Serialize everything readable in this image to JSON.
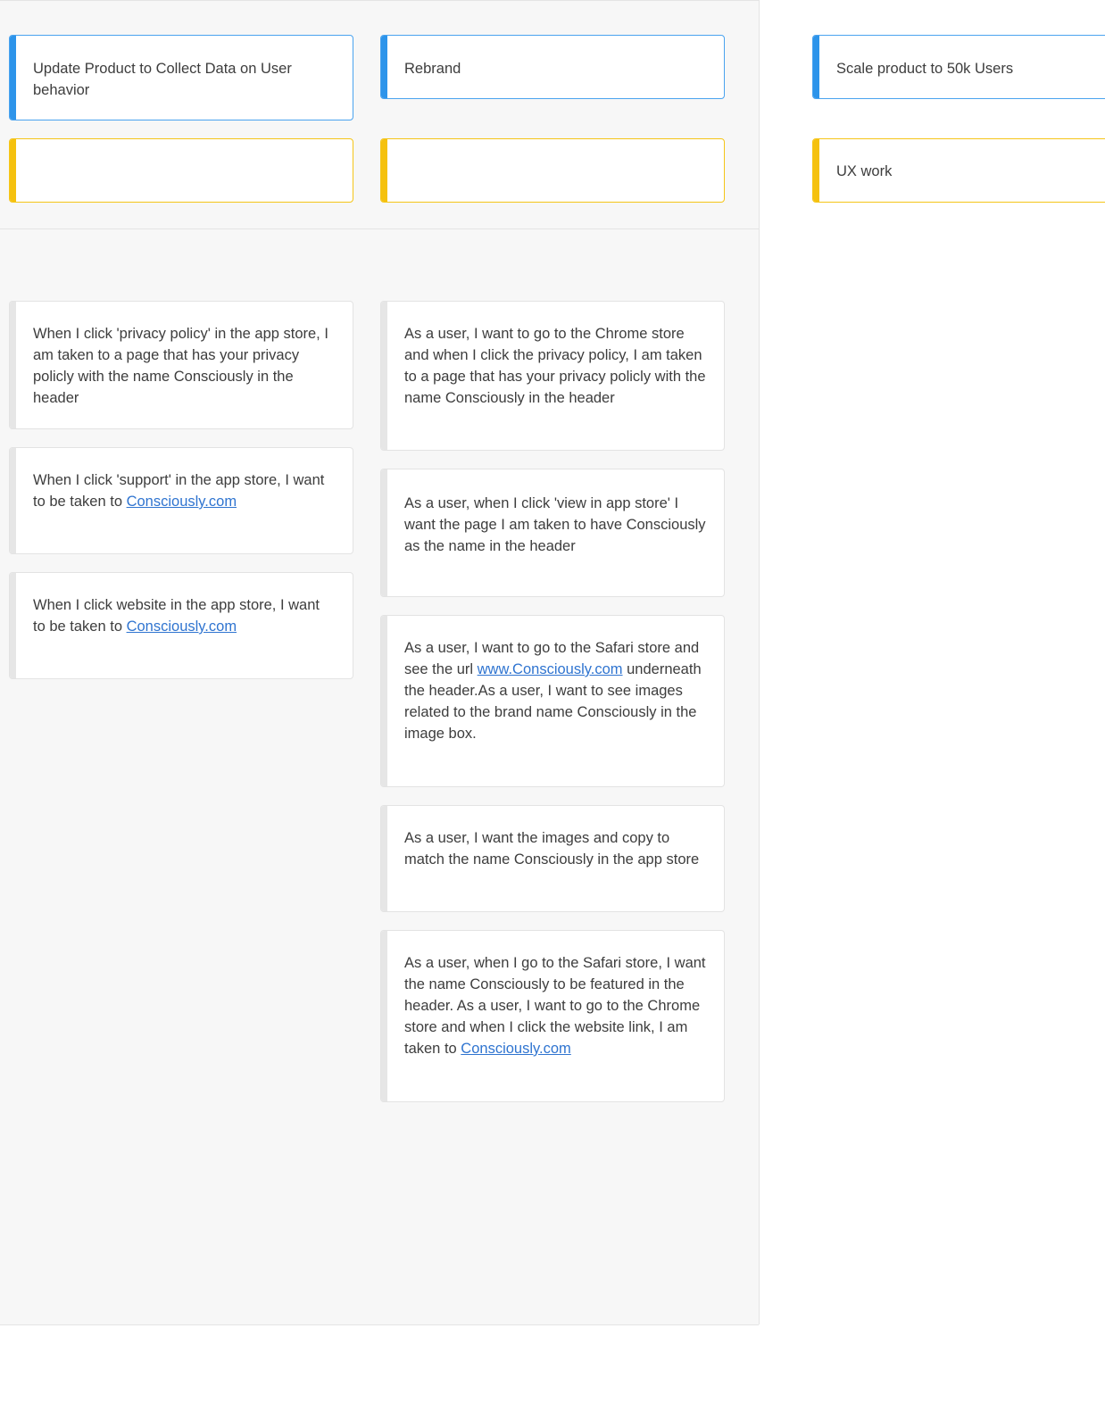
{
  "epics": [
    {
      "label": "Update Product to Collect Data on User behavior"
    },
    {
      "label": "Rebrand"
    },
    {
      "label": "Scale product to 50k Users"
    }
  ],
  "features": [
    {
      "label": ""
    },
    {
      "label": ""
    },
    {
      "label": "UX work"
    }
  ],
  "stories_col1": [
    {
      "text": "When I click 'privacy policy' in the app store, I am taken to a page that has your privacy policly with the name Consciously in the header",
      "link": ""
    },
    {
      "text": "When I click 'support' in the app store, I want to be taken to ",
      "link": "Consciously.com"
    },
    {
      "text": "When I click website in the app store, I want to be taken to ",
      "link": "Consciously.com"
    }
  ],
  "stories_col2": [
    {
      "text": "As a user, I want to go to the Chrome store and when I click the privacy policy, I am taken to a page that has your privacy policly with the name Consciously in the header"
    },
    {
      "text": "As a user, when I click 'view in app store' I want the page I am taken to have Consciously as the name in the header"
    },
    {
      "text_before": "As a user, I want to go to the Safari store and see the url ",
      "link": "www.Consciously.com",
      "text_after": " underneath the header.As a user, I want to see images related to the brand name Consciously in the image box."
    },
    {
      "text": "As a user, I want the images and copy to match the name Consciously in the app store"
    },
    {
      "text": "As a user, when I go to the Safari store, I want the name Consciously to be featured in the header. As a user, I want to go to the Chrome store and when I click the website link, I am taken to ",
      "link": "Consciously.com"
    }
  ]
}
